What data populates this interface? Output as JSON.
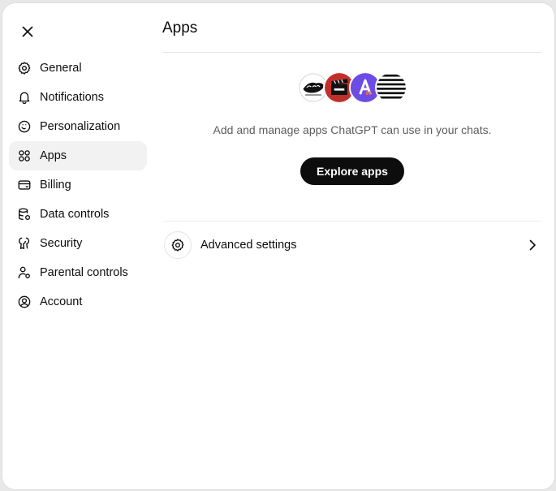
{
  "close_icon": "close-icon",
  "sidebar": {
    "items": [
      {
        "label": "General",
        "icon": "gear-icon"
      },
      {
        "label": "Notifications",
        "icon": "bell-icon"
      },
      {
        "label": "Personalization",
        "icon": "personalization-icon"
      },
      {
        "label": "Apps",
        "icon": "apps-grid-icon",
        "active": true
      },
      {
        "label": "Billing",
        "icon": "credit-card-icon"
      },
      {
        "label": "Data controls",
        "icon": "database-icon"
      },
      {
        "label": "Security",
        "icon": "shield-key-icon"
      },
      {
        "label": "Parental controls",
        "icon": "parental-icon"
      },
      {
        "label": "Account",
        "icon": "user-circle-icon"
      }
    ]
  },
  "main": {
    "title": "Apps",
    "app_logos": [
      "dont-wait-logo",
      "movie-clapper-logo",
      "a-purple-logo",
      "striped-sphere-logo"
    ],
    "description": "Add and manage apps ChatGPT can use in your chats.",
    "explore_label": "Explore apps",
    "advanced_label": "Advanced settings"
  },
  "colors": {
    "background": "#ffffff",
    "active_nav": "#f2f2f2",
    "primary_button": "#0d0d0d",
    "muted_text": "#5d5d5d",
    "purple_logo": "#6d4ce6",
    "red_logo": "#c0302a"
  }
}
